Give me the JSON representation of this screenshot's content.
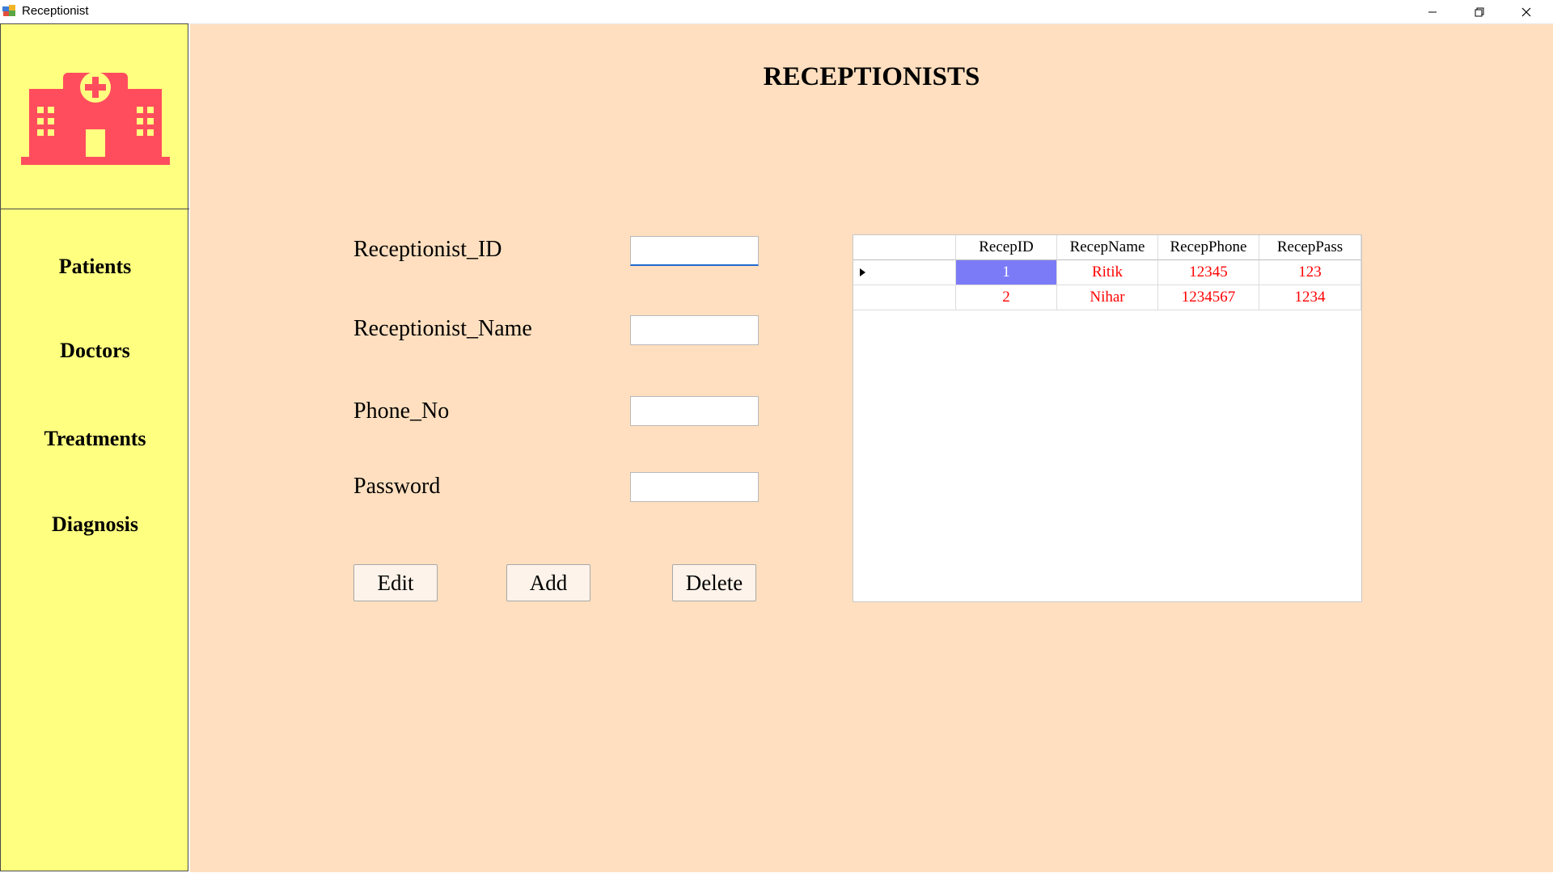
{
  "window": {
    "title": "Receptionist",
    "controls": [
      "minimize-icon",
      "restore-icon",
      "close-icon"
    ]
  },
  "sidebar": {
    "logo_icon": "hospital-icon",
    "logo_color": "#ff4d5e",
    "items": [
      {
        "label": "Patients"
      },
      {
        "label": "Doctors"
      },
      {
        "label": "Treatments"
      },
      {
        "label": "Diagnosis"
      }
    ]
  },
  "main": {
    "title": "RECEPTIONISTS",
    "fields": [
      {
        "label": "Receptionist_ID",
        "value": ""
      },
      {
        "label": "Receptionist_Name",
        "value": ""
      },
      {
        "label": "Phone_No",
        "value": ""
      },
      {
        "label": "Password",
        "value": ""
      }
    ],
    "buttons": {
      "edit": "Edit",
      "add": "Add",
      "delete": "Delete"
    }
  },
  "grid": {
    "columns": [
      "RecepID",
      "RecepName",
      "RecepPhone",
      "RecepPass"
    ],
    "rows": [
      {
        "id": "1",
        "name": "Ritik",
        "phone": "12345",
        "pass": "123"
      },
      {
        "id": "2",
        "name": "Nihar",
        "phone": "1234567",
        "pass": "1234"
      }
    ],
    "selected_row": 1,
    "cell_text_color": "#ff0000",
    "selection_color": "#7b7bf7"
  },
  "colors": {
    "sidebar_bg": "#ffff80",
    "main_bg": "#ffdfbf"
  }
}
